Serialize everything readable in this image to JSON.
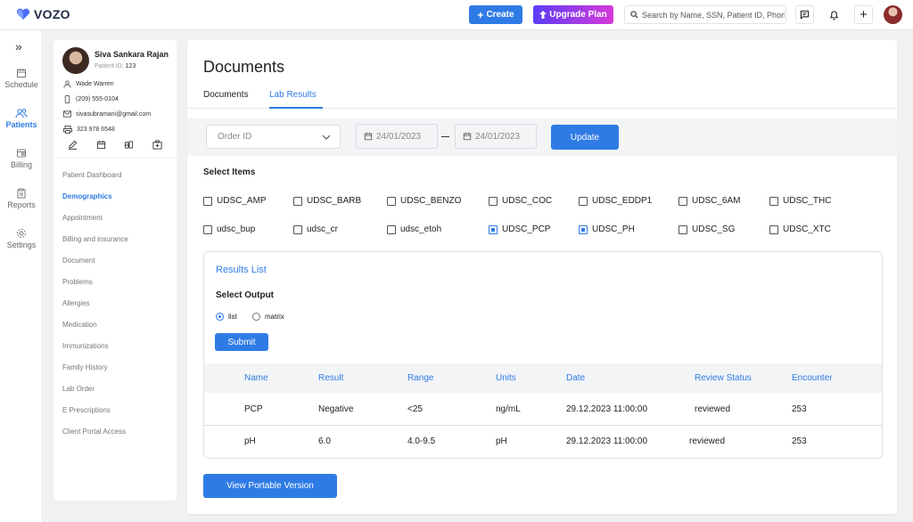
{
  "app": {
    "brand": "VOZO"
  },
  "topbar": {
    "create_label": "Create",
    "upgrade_label": "Upgrade Plan",
    "search_placeholder": "Search by Name, SSN, Patient ID, Phone"
  },
  "leftnav": {
    "items": [
      {
        "label": "Schedule",
        "icon": "calendar-icon"
      },
      {
        "label": "Patients",
        "icon": "users-icon"
      },
      {
        "label": "Billing",
        "icon": "billing-icon"
      },
      {
        "label": "Reports",
        "icon": "clipboard-icon"
      },
      {
        "label": "Settings",
        "icon": "gear-icon"
      }
    ]
  },
  "patient": {
    "name": "Siva Sankara Rajan",
    "id_label": "Patient ID:",
    "id_value": "123",
    "contact_person": "Wade Warren",
    "phone": "(209) 555-0104",
    "email": "sivasubramani@gmail.com",
    "fax": "323 978 6548",
    "menu": [
      "Patient Dashboard",
      "Demographics",
      "Appointment",
      "Billing and insurance",
      "Document",
      "Problems",
      "Allergies",
      "Medication",
      "Immunizations",
      "Family History",
      "Lab Order",
      "E Prescriptions",
      "Client Portal Access"
    ]
  },
  "main": {
    "title": "Documents",
    "tabs": [
      "Documents",
      "Lab Results"
    ],
    "filters": {
      "order_placeholder": "Order ID",
      "date_from": "24/01/2023",
      "date_to": "24/01/2023",
      "update_label": "Update"
    },
    "select_items_label": "Select Items",
    "items": [
      {
        "label": "UDSC_AMP",
        "checked": false
      },
      {
        "label": "UDSC_BARB",
        "checked": false
      },
      {
        "label": "UDSC_BENZO",
        "checked": false
      },
      {
        "label": "UDSC_COC",
        "checked": false
      },
      {
        "label": "UDSC_EDDP1",
        "checked": false
      },
      {
        "label": "UDSC_6AM",
        "checked": false
      },
      {
        "label": "UDSC_THC",
        "checked": false
      },
      {
        "label": "udsc_bup",
        "checked": false
      },
      {
        "label": "udsc_cr",
        "checked": false
      },
      {
        "label": "udsc_etoh",
        "checked": false
      },
      {
        "label": "UDSC_PCP",
        "checked": true
      },
      {
        "label": "UDSC_PH",
        "checked": true
      },
      {
        "label": "UDSC_SG",
        "checked": false
      },
      {
        "label": "UDSC_XTC",
        "checked": false
      }
    ],
    "results": {
      "title": "Results List",
      "select_output_label": "Select Output",
      "output_options": [
        "list",
        "matrix"
      ],
      "selected_output": "list",
      "submit_label": "Submit",
      "columns": [
        "Name",
        "Result",
        "Range",
        "Units",
        "Date",
        "Review Status",
        "Encounter"
      ],
      "rows": [
        [
          "PCP",
          "Negative",
          "<25",
          "ng/mL",
          "29.12.2023 11:00:00",
          "reviewed",
          "253"
        ],
        [
          "pH",
          "6.0",
          "4.0-9.5",
          "pH",
          "29.12.2023 11:00:00",
          "reviewed",
          "253"
        ]
      ]
    },
    "portable_label": "View Portable Version"
  },
  "colors": {
    "accent": "#2f7be5",
    "upgrade_from": "#5b3df5",
    "upgrade_to": "#d63ad8"
  }
}
